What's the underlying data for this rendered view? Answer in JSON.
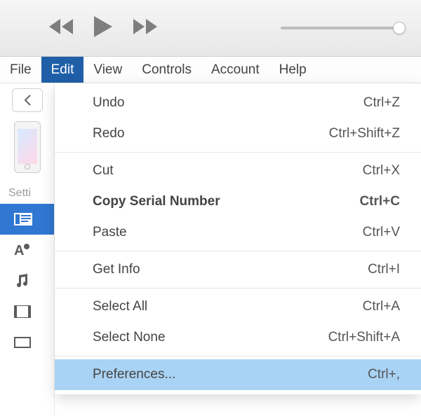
{
  "menubar": {
    "file": "File",
    "edit": "Edit",
    "view": "View",
    "controls": "Controls",
    "account": "Account",
    "help": "Help"
  },
  "sidebar": {
    "settings_label": "Setti"
  },
  "edit_menu": {
    "undo": {
      "label": "Undo",
      "shortcut": "Ctrl+Z"
    },
    "redo": {
      "label": "Redo",
      "shortcut": "Ctrl+Shift+Z"
    },
    "cut": {
      "label": "Cut",
      "shortcut": "Ctrl+X"
    },
    "copy_serial": {
      "label": "Copy Serial Number",
      "shortcut": "Ctrl+C"
    },
    "paste": {
      "label": "Paste",
      "shortcut": "Ctrl+V"
    },
    "get_info": {
      "label": "Get Info",
      "shortcut": "Ctrl+I"
    },
    "select_all": {
      "label": "Select All",
      "shortcut": "Ctrl+A"
    },
    "select_none": {
      "label": "Select None",
      "shortcut": "Ctrl+Shift+A"
    },
    "preferences": {
      "label": "Preferences...",
      "shortcut": "Ctrl+,"
    }
  }
}
